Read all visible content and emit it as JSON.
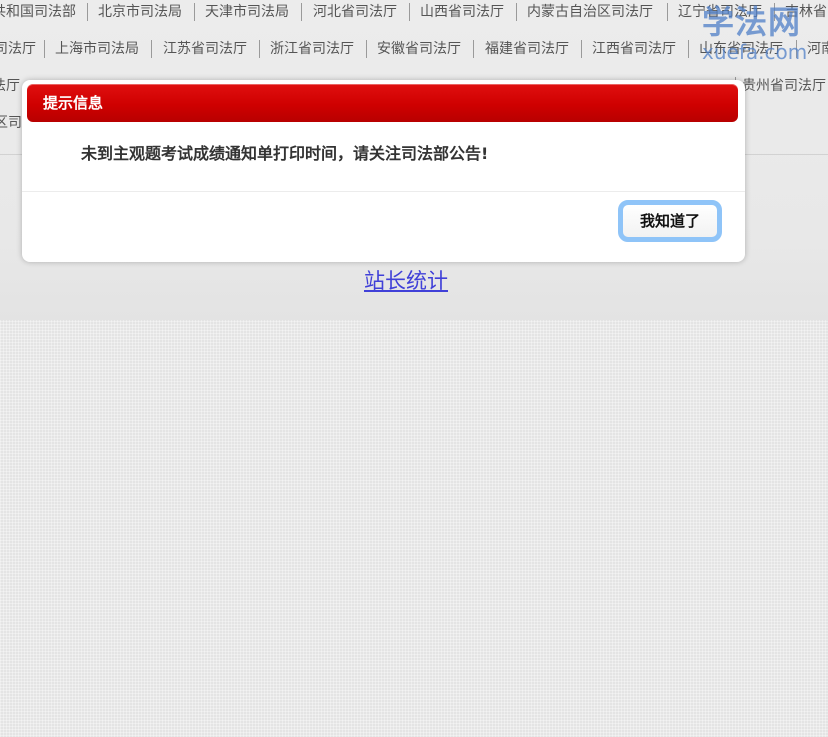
{
  "nav": {
    "row1": [
      "共和国司法部",
      "北京市司法局",
      "天津市司法局",
      "河北省司法厅",
      "山西省司法厅",
      "内蒙古自治区司法厅",
      "辽宁省司法厅",
      "吉林省"
    ],
    "row2": [
      "司法厅",
      "上海市司法局",
      "江苏省司法厅",
      "浙江省司法厅",
      "安徽省司法厅",
      "福建省司法厅",
      "江西省司法厅",
      "山东省司法厅",
      "河南"
    ],
    "row3": [
      "法厅",
      "贵州省司法厅"
    ],
    "row4": [
      "区司"
    ]
  },
  "logo": {
    "cn": "学法网",
    "en": "xuefa.com"
  },
  "footer": {
    "stats_link": "站长统计"
  },
  "dialog": {
    "title": "提示信息",
    "message": "未到主观题考试成绩通知单打印时间，请关注司法部公告!",
    "ok_label": "我知道了"
  },
  "colors": {
    "dialog_header": "#cf0000",
    "button_focus_ring": "#8fc4f8",
    "link": "#4040d8",
    "logo": "#4f7fc8"
  }
}
